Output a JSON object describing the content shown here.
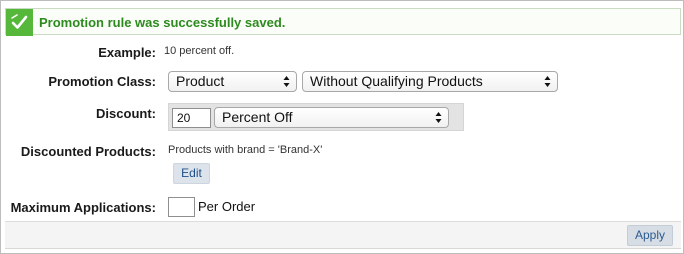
{
  "banner": {
    "message": "Promotion rule was successfully saved.",
    "icon": "success-check-icon",
    "color": "#55b83a"
  },
  "example": {
    "label": "Example:",
    "value": "10 percent off."
  },
  "promotion_class": {
    "label": "Promotion Class:",
    "class_value": "Product",
    "qualifier_value": "Without Qualifying Products"
  },
  "discount": {
    "label": "Discount:",
    "amount": "20",
    "type_value": "Percent Off"
  },
  "discounted_products": {
    "label": "Discounted Products:",
    "value": "Products with brand = 'Brand-X'",
    "edit_label": "Edit"
  },
  "max_applications": {
    "label": "Maximum Applications:",
    "value": "",
    "unit": "Per Order"
  },
  "footer": {
    "apply_label": "Apply"
  }
}
